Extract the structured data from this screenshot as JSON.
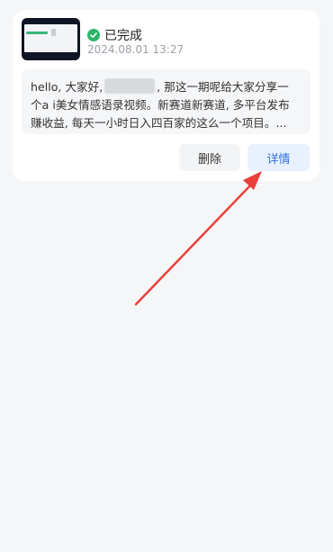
{
  "card": {
    "status": "已完成",
    "timestamp": "2024.08.01 13:27",
    "description": {
      "line1_part1": "hello, 大家好,",
      "line1_part2": ", 那这一期呢给大家分享一",
      "line2": "个a i美女情感语录视频。新赛道新赛道, 多平台发布",
      "line3": "赚收益, 每天一小时日入四百家的这么一个项目。..."
    },
    "actions": {
      "delete_label": "删除",
      "detail_label": "详情"
    }
  },
  "colors": {
    "status_green": "#2fb36a",
    "detail_blue": "#2f6fdc",
    "annotation_red": "#e8413a"
  }
}
